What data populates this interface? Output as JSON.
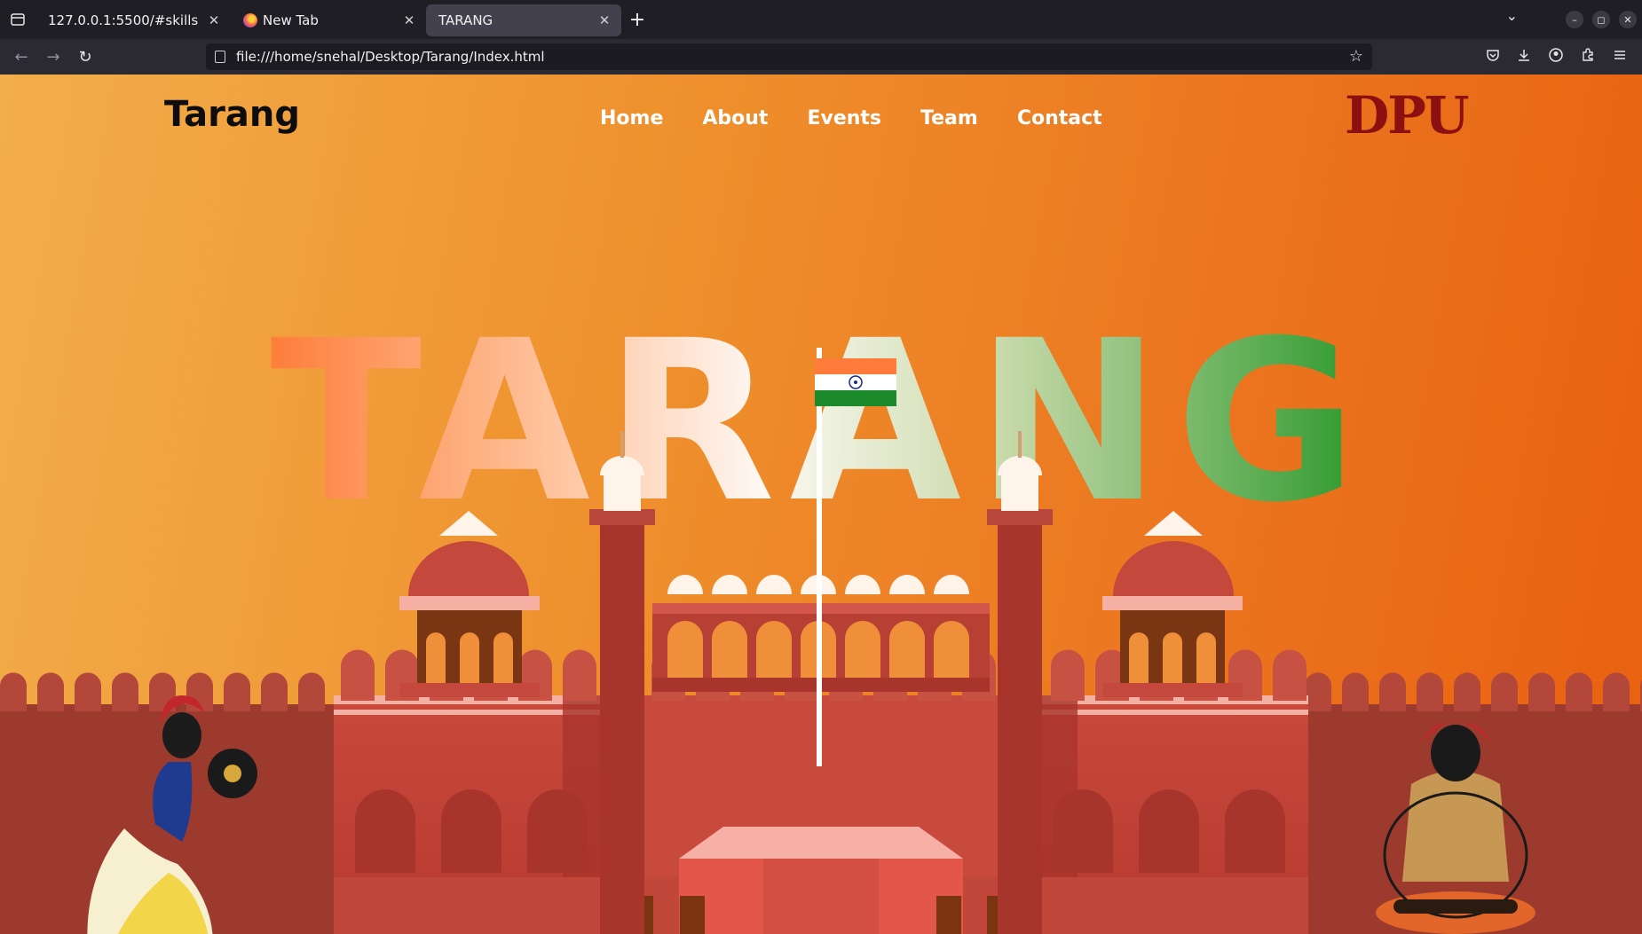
{
  "browser": {
    "tabs": [
      {
        "title": "127.0.0.1:5500/#skills",
        "active": false
      },
      {
        "title": "New Tab",
        "active": false
      },
      {
        "title": "TARANG",
        "active": true
      }
    ],
    "url": "file:///home/snehal/Desktop/Tarang/Index.html"
  },
  "site": {
    "brand": "Tarang",
    "nav": [
      "Home",
      "About",
      "Events",
      "Team",
      "Contact"
    ],
    "logo_text": "DPU",
    "hero_title": "TARANG"
  },
  "colors": {
    "saffron": "#ff7b3a",
    "white": "#ffffff",
    "green": "#1f9a2a",
    "fort_red": "#c9493b",
    "logo_red": "#8d1010"
  }
}
